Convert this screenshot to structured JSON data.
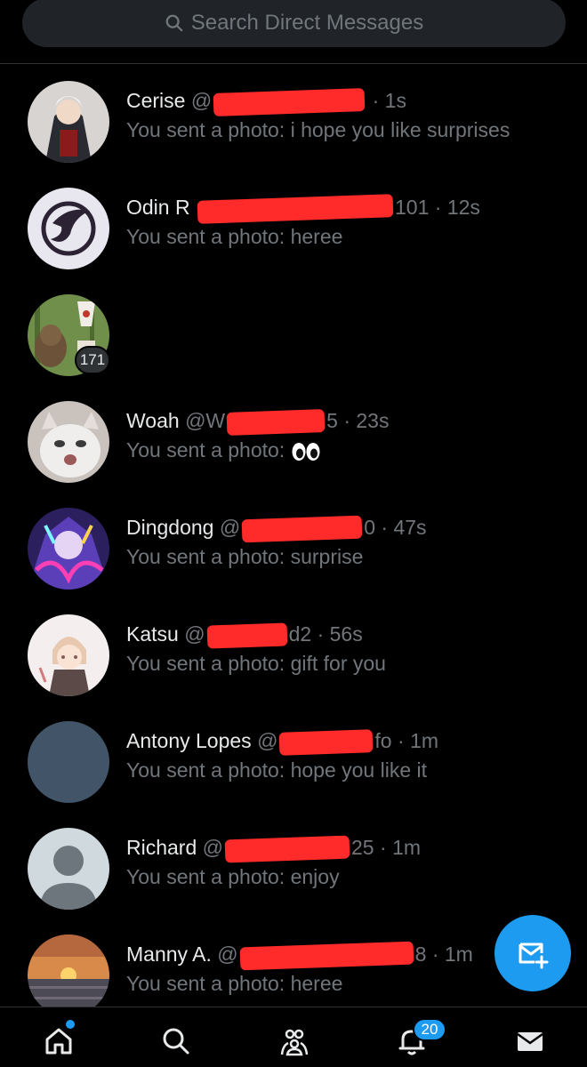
{
  "search": {
    "placeholder": "Search Direct Messages"
  },
  "conversations": [
    {
      "name": "Cerise",
      "handle_prefix": "@",
      "handle_suffix": "",
      "time": "1s",
      "preview": "You sent a photo: i hope you like surprises"
    },
    {
      "name": "Odin R",
      "handle_prefix": "",
      "handle_suffix": "101",
      "time": "12s",
      "preview": "You sent a photo: heree"
    },
    {
      "name": "",
      "handle_prefix": "",
      "handle_suffix": "",
      "time": "",
      "preview": "",
      "count_badge": "171"
    },
    {
      "name": "Woah",
      "handle_prefix": "@W",
      "handle_suffix": "5",
      "time": "23s",
      "preview": "You sent a photo:",
      "preview_emoji": "eyes"
    },
    {
      "name": "Dingdong",
      "handle_prefix": "@",
      "handle_suffix": "0",
      "time": "47s",
      "preview": "You sent a photo: surprise"
    },
    {
      "name": "Katsu",
      "handle_prefix": "@",
      "handle_suffix": "d2",
      "time": "56s",
      "preview": "You sent a photo: gift for you"
    },
    {
      "name": "Antony Lopes",
      "handle_prefix": "@",
      "handle_suffix": "fo",
      "time": "1m",
      "preview": "You sent a photo: hope you like it"
    },
    {
      "name": "Richard",
      "handle_prefix": "@",
      "handle_suffix": "25",
      "time": "1m",
      "preview": "You sent a photo: enjoy"
    },
    {
      "name": "Manny A.",
      "handle_prefix": "@",
      "handle_suffix": "8",
      "time": "1m",
      "preview": "You sent a photo: heree"
    }
  ],
  "separator": "·",
  "nav": {
    "notifications_badge": "20"
  },
  "colors": {
    "accent": "#1d9bf0",
    "background": "#000000",
    "muted": "#71767b",
    "redaction": "#ff2a2a"
  }
}
